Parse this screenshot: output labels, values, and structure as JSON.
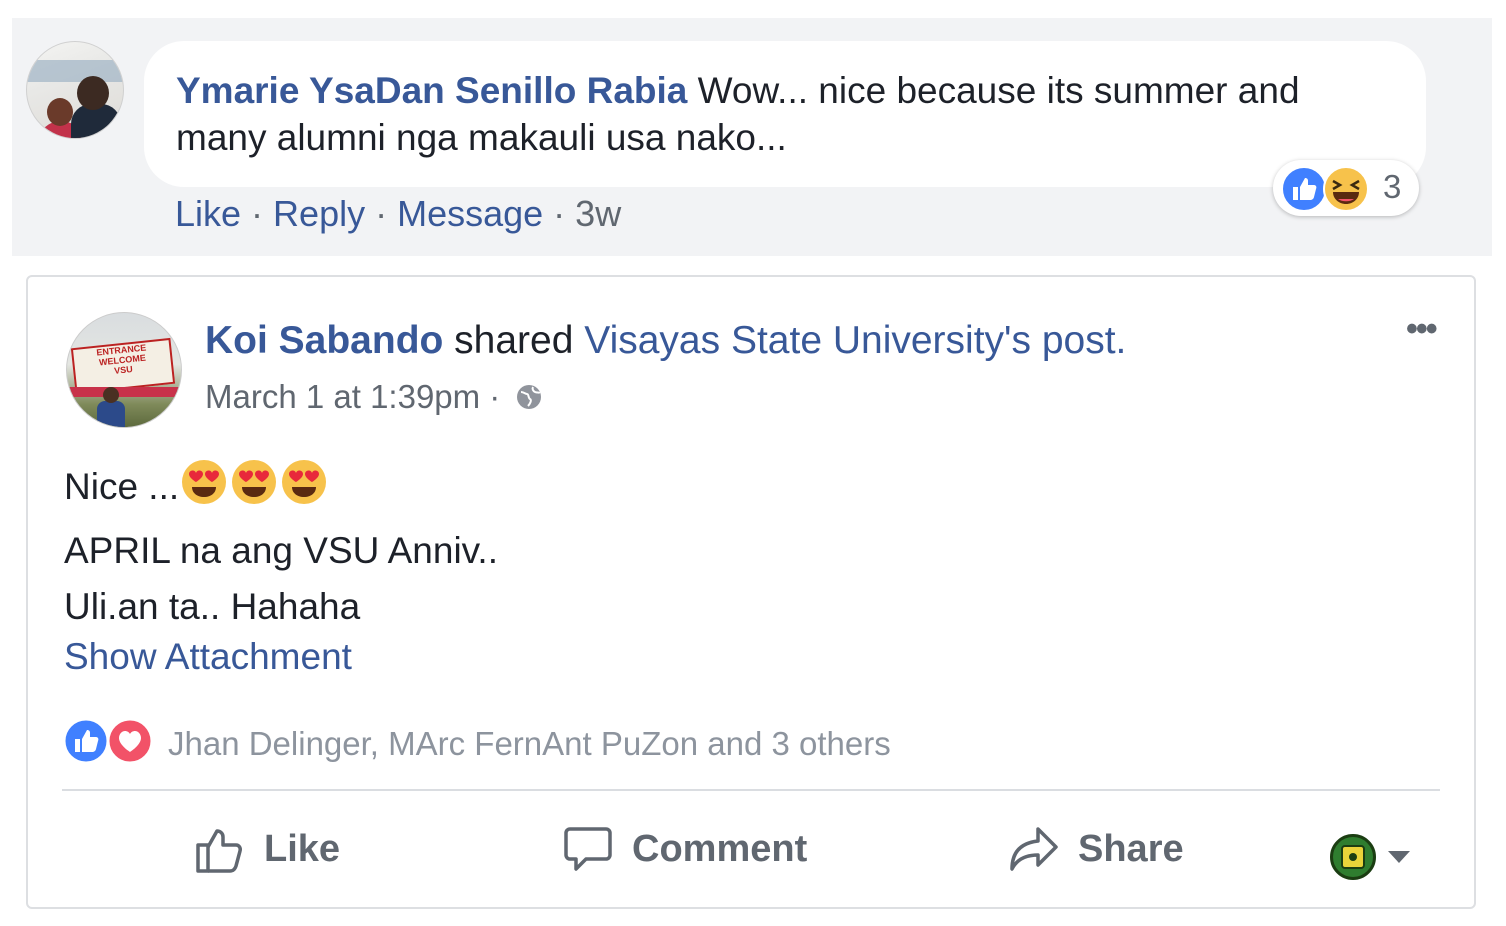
{
  "comment": {
    "author": "Ymarie YsaDan Senillo Rabia",
    "text": "Wow... nice because its summer and many alumni nga makauli usa nako...",
    "reaction_count": "3",
    "reaction_icons": [
      "like-icon",
      "haha-icon"
    ],
    "actions": {
      "like": "Like",
      "reply": "Reply",
      "message": "Message",
      "separator": " · ",
      "time": "3w"
    }
  },
  "post": {
    "author": "Koi Sabando",
    "shared_text": " shared ",
    "shared_source": "Visayas State University's post.",
    "timestamp": "March 1 at 1:39pm · ",
    "privacy_icon": "globe-icon",
    "more": "•••",
    "body_lines": [
      "Nice ...",
      "APRIL na ang VSU Anniv..",
      "Uli.an ta.. Hahaha"
    ],
    "body_emojis": [
      "heart-eyes-icon",
      "heart-eyes-icon",
      "heart-eyes-icon"
    ],
    "show_attachment": "Show Attachment",
    "reactions_summary": "Jhan Delinger, MArc FernAnt PuZon and 3 others",
    "reaction_icons": [
      "like-icon",
      "love-icon"
    ],
    "actions": {
      "like": "Like",
      "comment": "Comment",
      "share": "Share"
    }
  },
  "colors": {
    "link": "#385898",
    "secondary_text": "#606770",
    "muted_text": "#8d949e",
    "comment_bg": "#f2f3f5",
    "like_blue": "#4080ff",
    "love_red": "#f25268",
    "haha_yellow": "#f7c24b"
  }
}
